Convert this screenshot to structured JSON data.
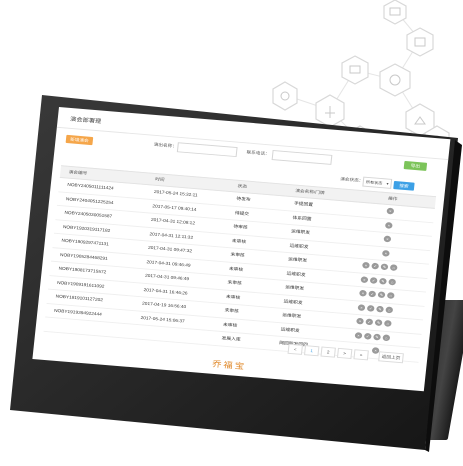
{
  "screen": {
    "title": "演会部署理",
    "buttons": {
      "add": "新增演会",
      "export": "导出",
      "search": "搜索"
    },
    "filters": {
      "name_label": "演出名称：",
      "contact_label": "联系电话：",
      "status_label": "演会状态：",
      "status_value": "所有状态"
    },
    "table": {
      "headers": [
        "演会编号",
        "时间",
        "状态",
        "演会名称/门牌",
        "操作"
      ],
      "rows": [
        {
          "id": "NOBY2405011111424",
          "time": "2017-05-24 15:32:11",
          "status": "待发布",
          "name": "手提回置",
          "ops": 1
        },
        {
          "id": "NOBY2404051225254",
          "time": "2017-05-17 09:40:14",
          "status": "待提交",
          "name": "体系回置",
          "ops": 1
        },
        {
          "id": "NOBY2405030051587",
          "time": "2017-04-31 12:08:12",
          "status": "待审核",
          "name": "运维职发",
          "ops": 1
        },
        {
          "id": "NOBY1920319117182",
          "time": "2017-04-31 12:11:32",
          "status": "未审核",
          "name": "运维职发",
          "ops": 1
        },
        {
          "id": "NOBY1909297471131",
          "time": "2017-04-31 09:47:32",
          "status": "未审核",
          "name": "运维职发",
          "ops": 4
        },
        {
          "id": "NOBY1905284468291",
          "time": "2017-04-31 09:46:49",
          "status": "未审核",
          "name": "运维职发",
          "ops": 4
        },
        {
          "id": "NOBY1908173715572",
          "time": "2017-04-31 09:46:49",
          "status": "未审核",
          "name": "运维职发",
          "ops": 4
        },
        {
          "id": "NOBY1909191611092",
          "time": "2017-04-31 16:46:26",
          "status": "未审核",
          "name": "运维职发",
          "ops": 4
        },
        {
          "id": "NOBY1819101127202",
          "time": "2017-04-19 16:56:40",
          "status": "未审核",
          "name": "运维职发",
          "ops": 4
        },
        {
          "id": "NOBY1919394922444",
          "time": "2017-05-24 15:06:37",
          "status": "未审核",
          "name": "运维职发",
          "ops": 4
        },
        {
          "id": "",
          "time": "",
          "status": "发展入库",
          "name": "网回职发回回",
          "ops": 1
        }
      ]
    },
    "pagination": {
      "prev": "<",
      "pages": [
        "1",
        "2"
      ],
      "next": ">",
      "last": "»",
      "back": "返回上页"
    },
    "footer_logo": "乔福宝"
  },
  "colors": {
    "orange": "#f5a64a",
    "green": "#7cc45a",
    "blue": "#3ca0e6",
    "logo": "#e08a2c"
  }
}
